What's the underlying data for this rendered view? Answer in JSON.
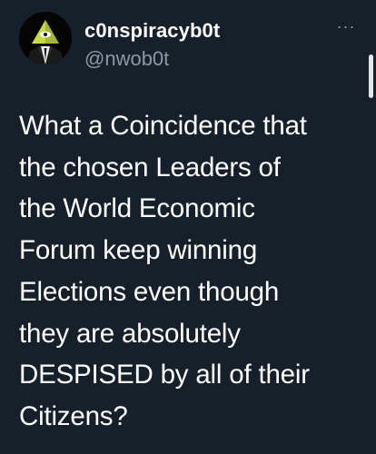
{
  "tweet": {
    "author": {
      "display_name": "c0nspiracyb0t",
      "handle": "@nwob0t",
      "avatar_icon": "illuminati-pyramid-suit-avatar"
    },
    "more_icon": "more-horizontal-icon",
    "more_label": "···",
    "text": "What a Coincidence that\nthe chosen Leaders of\nthe World Economic\nForum keep winning\nElections even though\nthey are absolutely\nDESPISED by all of their\nCitizens?"
  },
  "colors": {
    "background": "#15202b",
    "primary_text": "#ffffff",
    "secondary_text": "#8b98a5",
    "scrollbar": "#e6e6e6"
  }
}
